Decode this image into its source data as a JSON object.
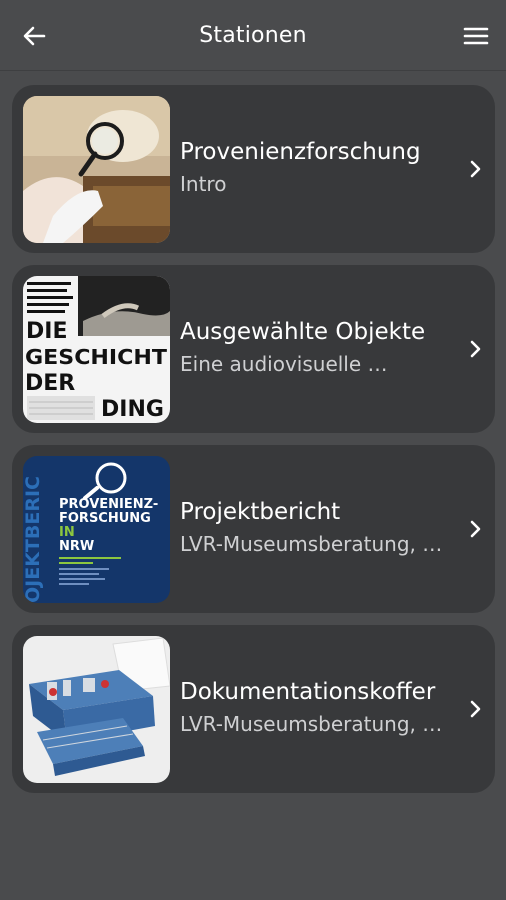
{
  "header": {
    "title": "Stationen",
    "back_icon": "arrow-left-icon",
    "menu_icon": "hamburger-menu-icon"
  },
  "stations": [
    {
      "title": "Provenienzforschung",
      "subtitle": "Intro",
      "thumbnail": "magnifier-photo"
    },
    {
      "title": "Ausgewählte Objekte",
      "subtitle": "Eine audiovisuelle …",
      "thumbnail": "poster-geschichte-der-ding",
      "poster_lines": [
        "DIE",
        "GESCHICHT",
        "DER",
        "DING"
      ]
    },
    {
      "title": "Projektbericht",
      "subtitle": "LVR-Museumsberatung, …",
      "thumbnail": "report-cover",
      "cover_lines": [
        "PROVENIENZ-",
        "FORSCHUNG",
        "IN",
        "NRW"
      ],
      "cover_spine": "OJEKTBERIC"
    },
    {
      "title": "Dokumentationskoffer",
      "subtitle": "LVR-Museumsberatung, …",
      "thumbnail": "toolbox-photo"
    }
  ],
  "colors": {
    "background": "#4a4b4d",
    "card": "#38393b",
    "subtitle": "#cfd0d2",
    "cover_blue": "#14366a",
    "cover_green": "#8cc63f"
  }
}
